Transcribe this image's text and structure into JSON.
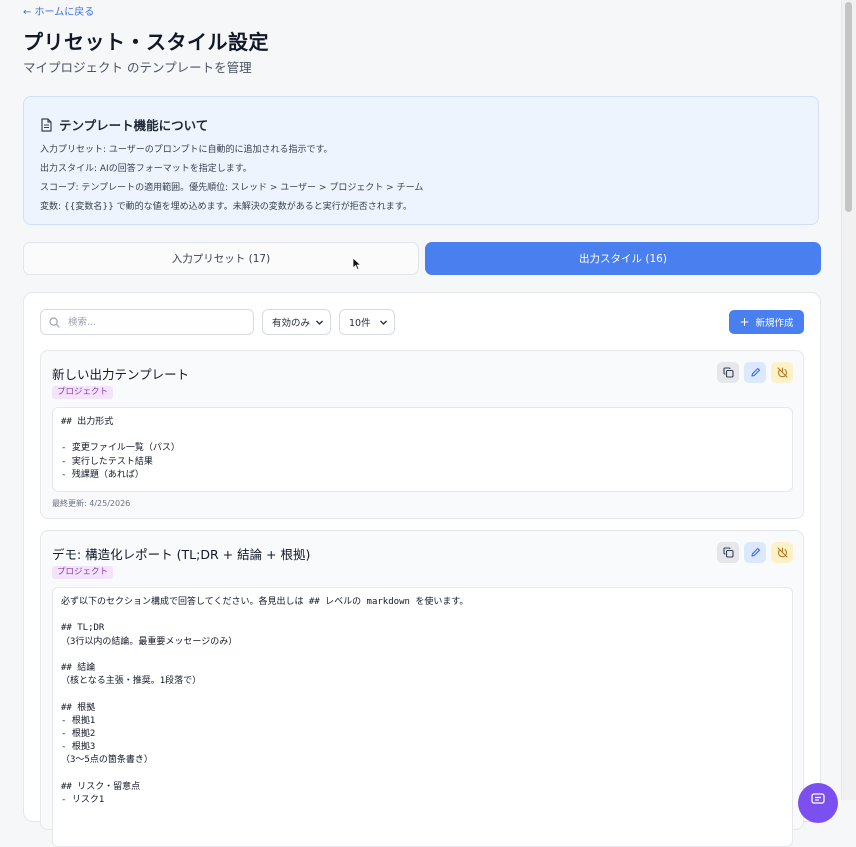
{
  "nav": {
    "back_label": "← ホームに戻る"
  },
  "header": {
    "title": "プリセット・スタイル設定",
    "subtitle": "マイプロジェクト のテンプレートを管理"
  },
  "info": {
    "title": "テンプレート機能について",
    "lines": [
      "入力プリセット: ユーザーのプロンプトに自動的に追加される指示です。",
      "出力スタイル: AIの回答フォーマットを指定します。",
      "スコープ: テンプレートの適用範囲。優先順位: スレッド > ユーザー > プロジェクト > チーム",
      "変数: {{変数名}} で動的な値を埋め込めます。未解決の変数があると実行が拒否されます。"
    ]
  },
  "tabs": [
    {
      "label": "入力プリセット (17)",
      "active": false
    },
    {
      "label": "出力スタイル (16)",
      "active": true
    }
  ],
  "toolbar": {
    "search_placeholder": "検索...",
    "filter_value": "有効のみ",
    "page_size_value": "10件",
    "new_label": "新規作成"
  },
  "templates": [
    {
      "title": "新しい出力テンプレート",
      "scope": "プロジェクト",
      "body": "## 出力形式\n\n- 変更ファイル一覧（パス）\n- 実行したテスト結果\n- 残課題（あれば）",
      "updated": "最終更新: 4/25/2026"
    },
    {
      "title": "デモ: 構造化レポート (TL;DR + 結論 + 根拠)",
      "scope": "プロジェクト",
      "body": "必ず以下のセクション構成で回答してください。各見出しは ## レベルの markdown を使います。\n\n## TL;DR\n（3行以内の結論。最重要メッセージのみ）\n\n## 結論\n（核となる主張・推奨。1段落で）\n\n## 根拠\n- 根拠1\n- 根拠2\n- 根拠3\n（3〜5点の箇条書き）\n\n## リスク・留意点\n- リスク1"
    }
  ],
  "colors": {
    "accent": "#4a7ff0",
    "info_bg": "#eef4fe",
    "scope_badge_text": "#8a3ab9",
    "scope_badge_bg": "#f3e3fb",
    "fab": "#7c4ff0"
  },
  "icons": {
    "info": "document-icon",
    "search": "search-icon",
    "new": "plus-icon",
    "copy": "copy-icon",
    "edit": "pencil-icon",
    "disable": "power-off-icon",
    "fab": "chat-icon"
  }
}
